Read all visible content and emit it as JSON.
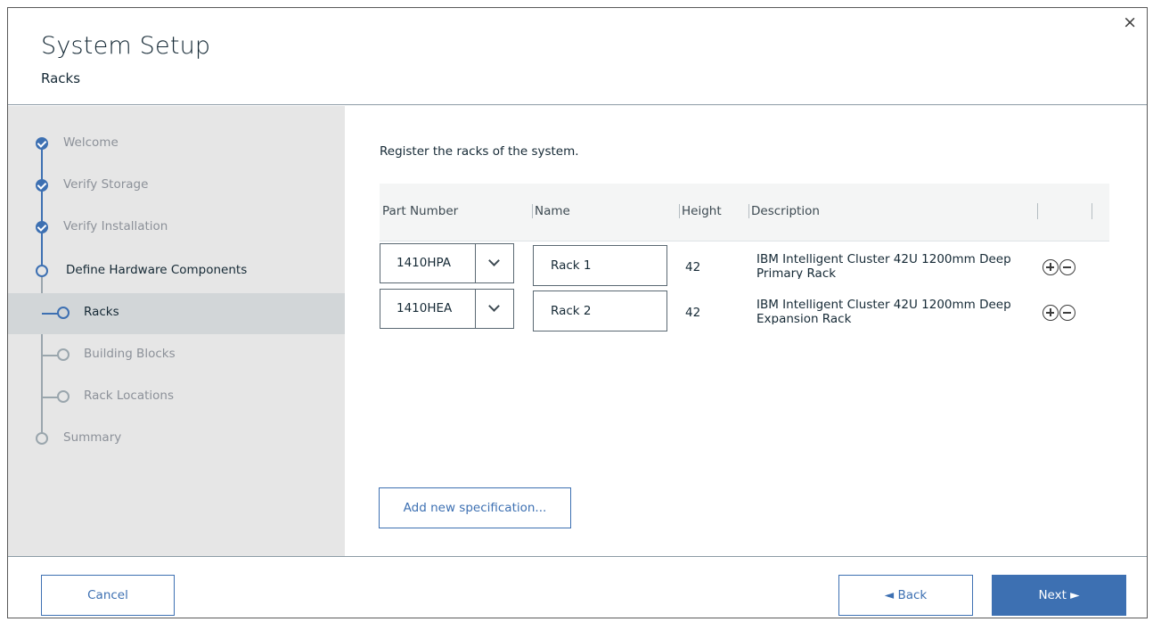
{
  "dialog": {
    "title": "System Setup",
    "subtitle": "Racks",
    "close_label": "×"
  },
  "steps": [
    {
      "label": "Welcome",
      "state": "done"
    },
    {
      "label": "Verify Storage",
      "state": "done"
    },
    {
      "label": "Verify Installation",
      "state": "done"
    },
    {
      "label": "Define Hardware Components",
      "state": "current"
    },
    {
      "label": "Racks",
      "state": "active"
    },
    {
      "label": "Building Blocks",
      "state": "todo"
    },
    {
      "label": "Rack Locations",
      "state": "todo"
    },
    {
      "label": "Summary",
      "state": "todo"
    }
  ],
  "main": {
    "intro": "Register the racks of the system.",
    "columns": [
      "Part Number",
      "Name",
      "Height",
      "Description"
    ],
    "rows": [
      {
        "part_number": "1410HPA",
        "name": "Rack 1",
        "height": "42",
        "description": "IBM Intelligent Cluster 42U 1200mm Deep Primary Rack"
      },
      {
        "part_number": "1410HEA",
        "name": "Rack 2",
        "height": "42",
        "description": "IBM Intelligent Cluster 42U 1200mm Deep Expansion Rack"
      }
    ],
    "add_spec_label": "Add new specification..."
  },
  "footer": {
    "cancel_label": "Cancel",
    "back_label": "◄ Back",
    "next_label": "Next ►"
  },
  "colors": {
    "accent": "#3d70b2",
    "sidebar_bg": "#e6e6e6",
    "active_step_bg": "#d2d6d8"
  }
}
